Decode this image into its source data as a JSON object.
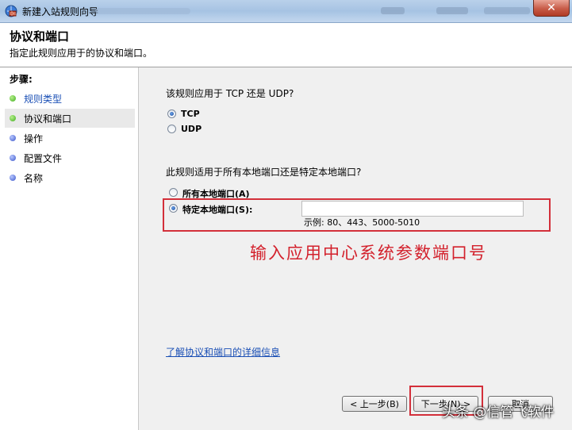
{
  "window": {
    "title": "新建入站规则向导",
    "close_glyph": "✕"
  },
  "header": {
    "title": "协议和端口",
    "subtitle": "指定此规则应用于的协议和端口。"
  },
  "steps": {
    "heading": "步骤:",
    "items": [
      {
        "label": "规则类型",
        "status": "green",
        "link": true
      },
      {
        "label": "协议和端口",
        "status": "green",
        "selected": true
      },
      {
        "label": "操作",
        "status": "blue"
      },
      {
        "label": "配置文件",
        "status": "blue"
      },
      {
        "label": "名称",
        "status": "blue"
      }
    ]
  },
  "protocol": {
    "question": "该规则应用于 TCP 还是 UDP?",
    "options": [
      {
        "label": "TCP",
        "checked": true
      },
      {
        "label": "UDP",
        "checked": false
      }
    ]
  },
  "ports": {
    "question": "此规则适用于所有本地端口还是特定本地端口?",
    "all_label": "所有本地端口(A)",
    "specific_label": "特定本地端口(S):",
    "specific_checked": true,
    "input_value": "",
    "example": "示例: 80、443、5000-5010"
  },
  "annotation": "输入应用中心系统参数端口号",
  "help_link": "了解协议和端口的详细信息",
  "buttons": {
    "back": "< 上一步(B)",
    "next": "下一步(N) >",
    "cancel": "取消"
  },
  "watermark": "头条 @信管飞软件"
}
